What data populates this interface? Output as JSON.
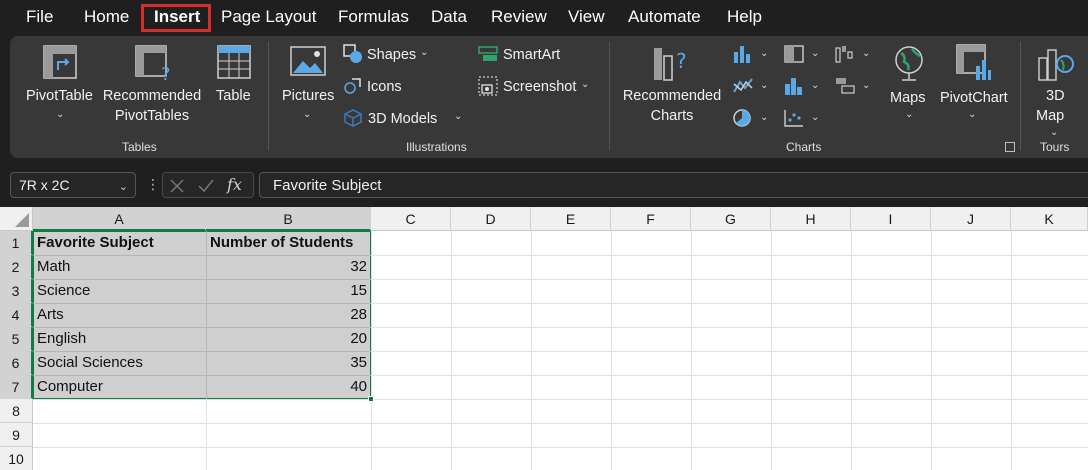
{
  "menu": {
    "items": [
      "File",
      "Home",
      "Insert",
      "Page Layout",
      "Formulas",
      "Data",
      "Review",
      "View",
      "Automate",
      "Help"
    ],
    "active": "Insert"
  },
  "ribbon": {
    "groups": {
      "tables": "Tables",
      "illustrations": "Illustrations",
      "charts": "Charts",
      "tours": "Tours"
    },
    "pivottable": "PivotTable",
    "recommended_pivottables_line1": "Recommended",
    "recommended_pivottables_line2": "PivotTables",
    "table": "Table",
    "pictures": "Pictures",
    "shapes": "Shapes",
    "icons": "Icons",
    "models_3d": "3D Models",
    "smartart": "SmartArt",
    "screenshot": "Screenshot",
    "recommended_charts_line1": "Recommended",
    "recommended_charts_line2": "Charts",
    "maps": "Maps",
    "pivotchart": "PivotChart",
    "map3d_line1": "3D",
    "map3d_line2": "Map"
  },
  "formula_bar": {
    "name_box": "7R x 2C",
    "fx": "fx",
    "value": "Favorite Subject"
  },
  "sheet": {
    "columns": [
      "A",
      "B",
      "C",
      "D",
      "E",
      "F",
      "G",
      "H",
      "I",
      "J",
      "K"
    ],
    "rows": [
      "1",
      "2",
      "3",
      "4",
      "5",
      "6",
      "7",
      "8",
      "9",
      "10"
    ],
    "headers": [
      "Favorite Subject",
      "Number of Students"
    ],
    "data": [
      {
        "subject": "Math",
        "students": "32"
      },
      {
        "subject": "Science",
        "students": "15"
      },
      {
        "subject": "Arts",
        "students": "28"
      },
      {
        "subject": "English",
        "students": "20"
      },
      {
        "subject": "Social Sciences",
        "students": "35"
      },
      {
        "subject": "Computer",
        "students": "40"
      }
    ]
  },
  "colors": {
    "accent_green": "#107c41",
    "highlight_red": "#d32f2f",
    "ribbon_bg": "#383838",
    "window_bg": "#1f1f1f"
  }
}
